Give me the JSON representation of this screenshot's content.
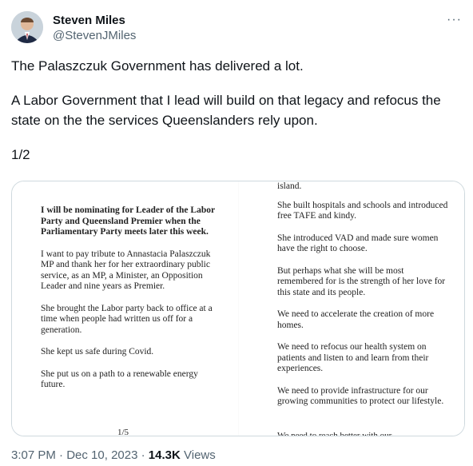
{
  "author": {
    "display_name": "Steven Miles",
    "handle": "@StevenJMiles",
    "avatar_icon": "person-photo-icon"
  },
  "more_label": "···",
  "tweet": {
    "paragraphs": [
      "The Palaszczuk Government has delivered a lot.",
      "A Labor Government that I lead will build on that legacy and refocus the state on the the services Queenslanders rely upon.",
      "1/2"
    ]
  },
  "document": {
    "left": {
      "heading": "I will be nominating for Leader of the Labor Party and Queensland Premier when the Parliamentary Party meets later this week.",
      "paragraphs": [
        "I want to pay tribute to Annastacia Palaszczuk MP and thank her for her extraordinary public service, as an MP, a Minister, an Opposition Leader and nine years as Premier.",
        "She brought the Labor party back to office at a time when people had written us off for a generation.",
        "She kept us safe during Covid.",
        "She put us on a path to a renewable energy future."
      ],
      "page_number": "1/5"
    },
    "right": {
      "paragraphs": [
        "island.",
        "She built hospitals and schools and introduced free TAFE and kindy.",
        "She introduced VAD and made sure women have the right to choose.",
        "But perhaps what she will be most remembered for is the strength of her love for this state and its people.",
        "We need to accelerate the creation of more homes.",
        "We need to refocus our health system on patients and listen to and learn from their experiences.",
        "We need to provide infrastructure for our growing communities to protect our lifestyle."
      ],
      "cut_line": "We need to reach better with our"
    }
  },
  "meta": {
    "time": "3:07 PM",
    "separator": "·",
    "date": "Dec 10, 2023",
    "views_count": "14.3K",
    "views_label": "Views"
  }
}
